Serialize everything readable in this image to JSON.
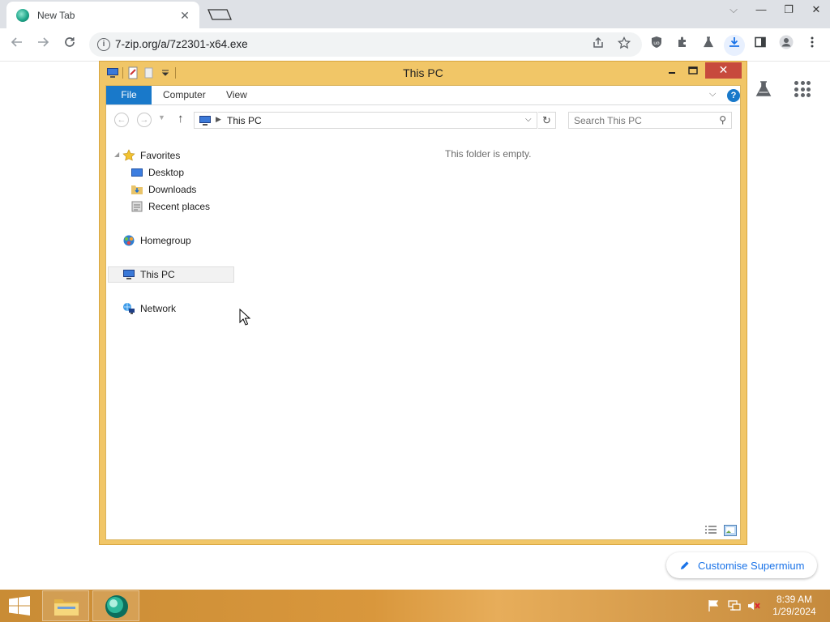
{
  "browser": {
    "tab_title": "New Tab",
    "tab_close": "✕",
    "url": "7-zip.org/a/7z2301-x64.exe",
    "win_min": "—",
    "win_restore": "❐",
    "win_close": "✕",
    "tab_search": "⌵"
  },
  "ntp": {
    "customise_label": "Customise Supermium"
  },
  "explorer": {
    "title": "This PC",
    "ribbon": {
      "file": "File",
      "computer": "Computer",
      "view": "View",
      "help": "?"
    },
    "address": {
      "location": "This PC"
    },
    "search": {
      "placeholder": "Search This PC"
    },
    "nav": {
      "favorites": "Favorites",
      "desktop": "Desktop",
      "downloads": "Downloads",
      "recent": "Recent places",
      "homegroup": "Homegroup",
      "this_pc": "This PC",
      "network": "Network"
    },
    "empty_message": "This folder is empty."
  },
  "taskbar": {
    "time": "8:39 AM",
    "date": "1/29/2024"
  },
  "colors": {
    "explorer_frame": "#f1c667",
    "ribbon_file": "#1979ca",
    "close_button": "#c74a3d",
    "link_blue": "#1a73e8"
  }
}
